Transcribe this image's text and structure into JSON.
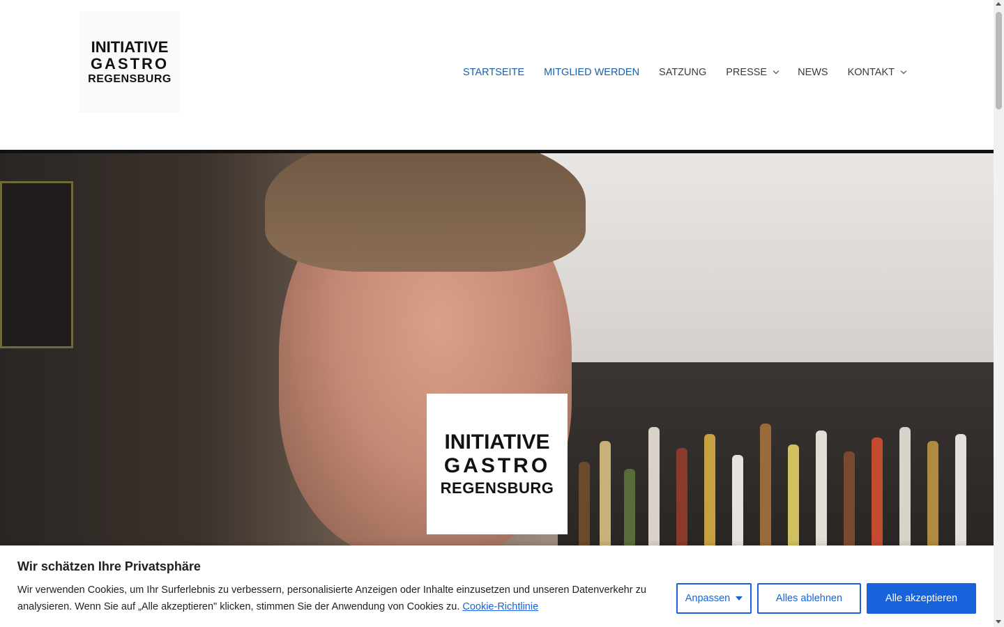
{
  "site": {
    "logo": {
      "line1": "INITIATIVE",
      "line2": "GASTRO",
      "line3": "REGENSBURG"
    }
  },
  "nav": {
    "items": [
      {
        "label": "STARTSEITE",
        "active": true,
        "dropdown": false
      },
      {
        "label": "MITGLIED WERDEN",
        "active": true,
        "dropdown": false
      },
      {
        "label": "SATZUNG",
        "active": false,
        "dropdown": false
      },
      {
        "label": "PRESSE",
        "active": false,
        "dropdown": true
      },
      {
        "label": "NEWS",
        "active": false,
        "dropdown": false
      },
      {
        "label": "KONTAKT",
        "active": false,
        "dropdown": true
      }
    ]
  },
  "hero": {
    "logo": {
      "line1": "INITIATIVE",
      "line2": "GASTRO",
      "line3": "REGENSBURG"
    }
  },
  "cookie": {
    "title": "Wir schätzen Ihre Privatsphäre",
    "text": "Wir verwenden Cookies, um Ihr Surferlebnis zu verbessern, personalisierte Anzeigen oder Inhalte einzusetzen und unseren Datenverkehr zu analysieren. Wenn Sie auf „Alle akzeptieren\" klicken, stimmen Sie der Anwendung von Cookies zu.",
    "link": "Cookie-Richtlinie",
    "customize_label": "Anpassen",
    "reject_label": "Alles ablehnen",
    "accept_label": "Alle akzeptieren"
  },
  "colors": {
    "nav_active": "#1b5fa8",
    "nav_text": "#3a3a3a",
    "cookie_accent": "#1863dc"
  }
}
